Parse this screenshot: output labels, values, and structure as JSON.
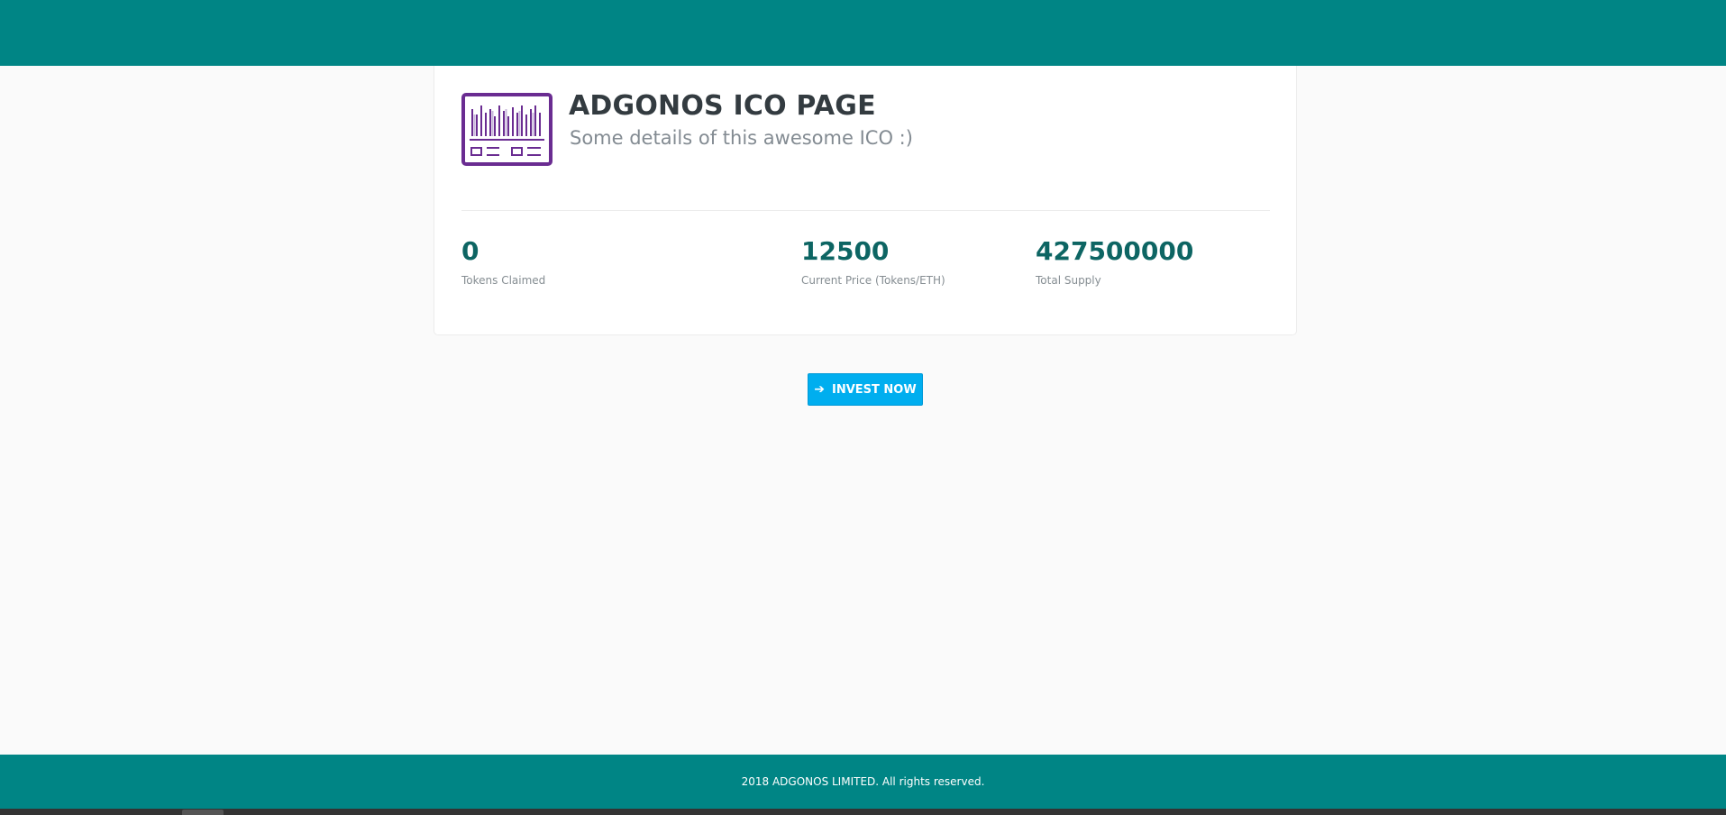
{
  "header": {
    "bar_color": "#008585"
  },
  "ico": {
    "logo_icon": "barcode-ticket-icon",
    "title": "ADGONOS ICO PAGE",
    "subtitle": "Some details of this awesome ICO :)"
  },
  "stats": [
    {
      "value": "0",
      "label": "Tokens Claimed"
    },
    {
      "value": "12500",
      "label": "Current Price (Tokens/ETH)"
    },
    {
      "value": "427500000",
      "label": "Total Supply"
    }
  ],
  "invest": {
    "icon": "arrow-right-icon",
    "label": "INVEST NOW",
    "color": "#00aeef"
  },
  "footer": {
    "text": "2018 ADGONOS LIMITED. All rights reserved.",
    "color": "#008585"
  }
}
